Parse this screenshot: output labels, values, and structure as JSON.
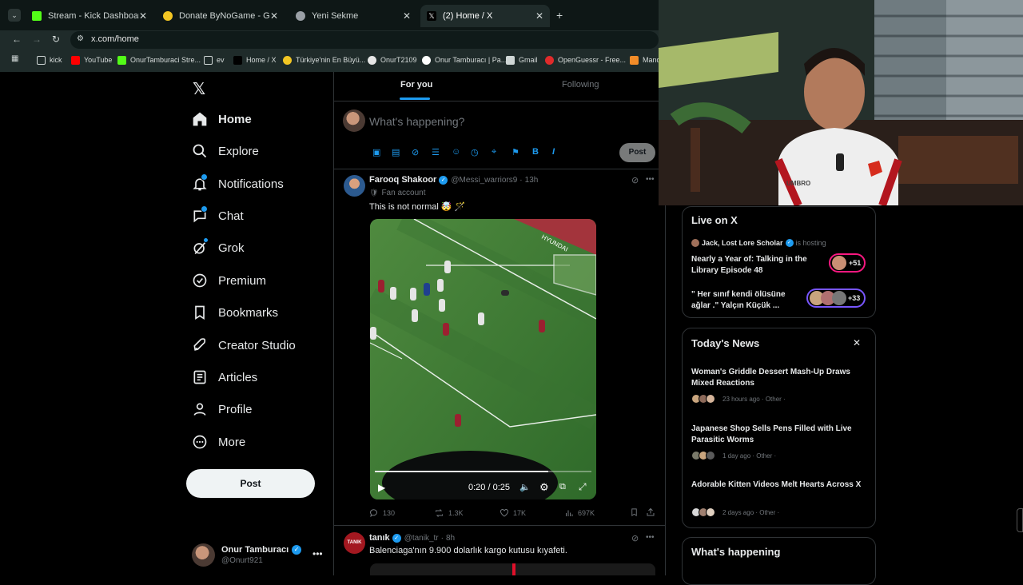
{
  "browser": {
    "tabs": [
      {
        "label": "Stream - Kick Dashboard",
        "favicon_color": "#53fc18"
      },
      {
        "label": "Donate ByNoGame - Gelen/Gid",
        "favicon_color": "#f3c623"
      },
      {
        "label": "Yeni Sekme",
        "favicon_color": "#9aa0a6"
      },
      {
        "label": "(2) Home / X",
        "favicon_color": "#ffffff"
      }
    ],
    "address": "x.com/home",
    "bookmarks": [
      {
        "label": "kick",
        "icon": "folder-icon"
      },
      {
        "label": "YouTube",
        "icon": "youtube-icon"
      },
      {
        "label": "OnurTamburaci Stre...",
        "icon": "kick-icon"
      },
      {
        "label": "ev",
        "icon": "folder-icon"
      },
      {
        "label": "Home / X",
        "icon": "x-icon"
      },
      {
        "label": "Türkiye'nin En Büyü...",
        "icon": "bynogame-icon"
      },
      {
        "label": "OnurT2109",
        "icon": "github-icon"
      },
      {
        "label": "Onur Tamburacı | Pa...",
        "icon": "patreon-icon"
      },
      {
        "label": "Gmail",
        "icon": "gmail-icon"
      },
      {
        "label": "OpenGuessr - Free...",
        "icon": "openguessr-icon"
      },
      {
        "label": "Mand",
        "icon": "generic-icon"
      }
    ]
  },
  "nav": {
    "items": [
      {
        "label": "Home",
        "icon": "home-icon"
      },
      {
        "label": "Explore",
        "icon": "search-icon"
      },
      {
        "label": "Notifications",
        "icon": "bell-icon"
      },
      {
        "label": "Chat",
        "icon": "chat-icon"
      },
      {
        "label": "Grok",
        "icon": "grok-icon"
      },
      {
        "label": "Premium",
        "icon": "premium-icon"
      },
      {
        "label": "Bookmarks",
        "icon": "bookmark-icon"
      },
      {
        "label": "Creator Studio",
        "icon": "rocket-icon"
      },
      {
        "label": "Articles",
        "icon": "articles-icon"
      },
      {
        "label": "Profile",
        "icon": "person-icon"
      },
      {
        "label": "More",
        "icon": "more-circle-icon"
      }
    ],
    "post_label": "Post",
    "account": {
      "name": "Onur Tamburacı",
      "handle": "@Onurt921"
    }
  },
  "feed": {
    "tabs": [
      "For you",
      "Following"
    ],
    "composer": {
      "placeholder": "What's happening?",
      "post_label": "Post"
    },
    "tweets": [
      {
        "name": "Farooq Shakoor",
        "handle": "@Messi_warriors9",
        "time": "13h",
        "badge": "Fan account",
        "text": "This is not normal 🤯 🪄",
        "video": {
          "time": "0:20 / 0:25",
          "progress": 0.8
        },
        "stats": {
          "replies": "130",
          "reposts": "1.3K",
          "likes": "17K",
          "views": "697K"
        }
      },
      {
        "name": "tanık",
        "handle": "@tanik_tr",
        "time": "8h",
        "avatar_text": "TANIK",
        "text": "Balenciaga'nın 9.900 dolarlık kargo kutusu kıyafeti."
      }
    ]
  },
  "live": {
    "title": "Live on X",
    "host": "Jack, Lost Lore Scholar",
    "host_suffix": "is hosting",
    "spaces": [
      {
        "title": "Nearly a Year of: Talking in the Library Episode 48",
        "count": "+51",
        "ring": "#f91880"
      },
      {
        "title": "\" Her sınıf kendi ölüsüne ağlar .\" Yalçın Küçük ...",
        "count": "+33",
        "ring": "#7856ff"
      }
    ]
  },
  "news": {
    "title": "Today's News",
    "items": [
      {
        "title": "Woman's Griddle Dessert Mash-Up Draws Mixed Reactions",
        "meta": "23 hours ago · Other ·"
      },
      {
        "title": "Japanese Shop Sells Pens Filled with Live Parasitic Worms",
        "meta": "1 day ago · Other ·"
      },
      {
        "title": "Adorable Kitten Videos Melt Hearts Across X",
        "meta": "2 days ago · Other ·"
      }
    ]
  },
  "happening": {
    "title": "What's happening"
  },
  "colors": {
    "accent": "#1d9bf0",
    "bg": "#000000",
    "border": "#2f3336",
    "muted": "#71767b"
  }
}
